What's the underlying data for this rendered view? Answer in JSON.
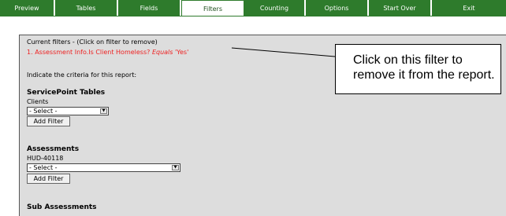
{
  "nav": {
    "tabs": [
      {
        "label": "Preview",
        "active": false
      },
      {
        "label": "Tables",
        "active": false
      },
      {
        "label": "Fields",
        "active": false
      },
      {
        "label": "Filters",
        "active": true
      },
      {
        "label": "Counting",
        "active": false
      },
      {
        "label": "Options",
        "active": false
      },
      {
        "label": "Start Over",
        "active": false
      },
      {
        "label": "Exit",
        "active": false
      }
    ]
  },
  "filters": {
    "header": "Current filters - (Click on filter to remove)",
    "items": [
      {
        "number": "1.",
        "field": "Assessment Info.Is Client Homeless?",
        "operator": "Equals",
        "value": "'Yes'"
      }
    ],
    "instruction": "Indicate the criteria for this report:"
  },
  "sections": [
    {
      "title": "ServicePoint Tables",
      "subtitle": "Clients",
      "select_value": "- Select -",
      "button": "Add Filter"
    },
    {
      "title": "Assessments",
      "subtitle": "HUD-40118",
      "select_value": "- Select -",
      "button": "Add Filter"
    },
    {
      "title": "Sub Assessments"
    }
  ],
  "callout": {
    "text": "Click on this filter to remove it from the report."
  },
  "colors": {
    "nav_green": "#2e7b2c",
    "filter_red": "#e22",
    "panel_gray": "#dddddd"
  }
}
